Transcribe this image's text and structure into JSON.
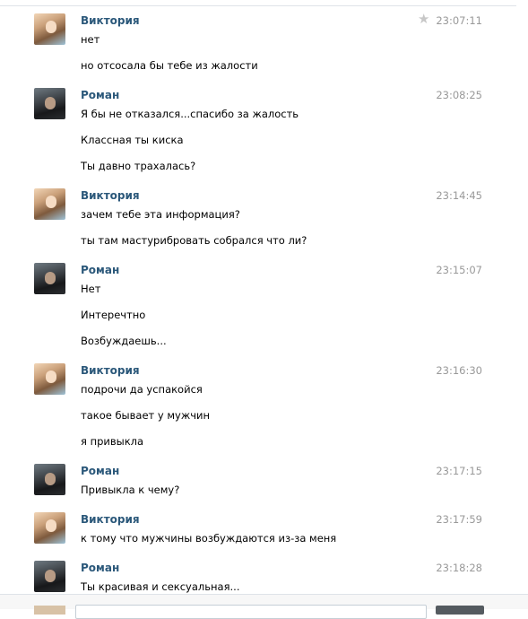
{
  "messages": [
    {
      "author": "Виктория",
      "time": "23:07:11",
      "starred": true,
      "avatar": "viktoria",
      "lines": [
        "нет",
        "но отсосала бы тебе из жалости"
      ]
    },
    {
      "author": "Роман",
      "time": "23:08:25",
      "avatar": "roman",
      "lines": [
        "Я бы не отказался...спасибо за жалость",
        "Классная ты киска",
        "Ты давно трахалась?"
      ]
    },
    {
      "author": "Виктория",
      "time": "23:14:45",
      "avatar": "viktoria",
      "lines": [
        "зачем тебе эта информация?",
        "ты там мастурибровать собрался что ли?"
      ]
    },
    {
      "author": "Роман",
      "time": "23:15:07",
      "avatar": "roman",
      "lines": [
        "Нет",
        "Интеречтно",
        "Возбуждаешь..."
      ]
    },
    {
      "author": "Виктория",
      "time": "23:16:30",
      "avatar": "viktoria",
      "lines": [
        "подрочи да успакойся",
        "такое бывает у мужчин",
        "я привыкла"
      ]
    },
    {
      "author": "Роман",
      "time": "23:17:15",
      "avatar": "roman",
      "lines": [
        "Привыкла к чему?"
      ]
    },
    {
      "author": "Виктория",
      "time": "23:17:59",
      "avatar": "viktoria",
      "lines": [
        "к тому что мужчины возбуждаются из-за меня"
      ]
    },
    {
      "author": "Роман",
      "time": "23:18:28",
      "avatar": "roman",
      "lines": [
        "Ты красивая и сексуальная..."
      ]
    }
  ],
  "icons": {
    "star": "star-icon"
  },
  "colors": {
    "author": "#2b587a",
    "time": "#999999",
    "separator": "#dfe3e8"
  }
}
